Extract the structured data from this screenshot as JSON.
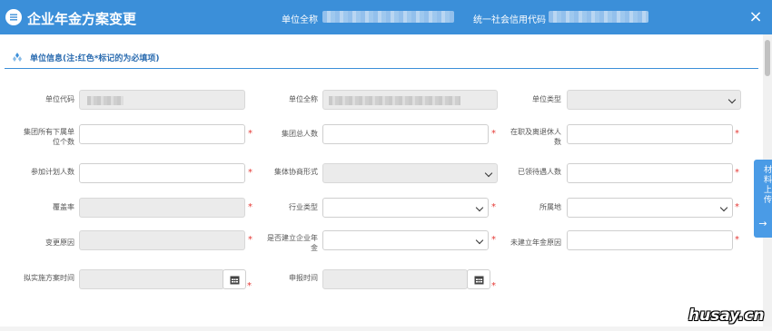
{
  "header": {
    "title": "企业年金方案变更",
    "unit_fullname_label": "单位全称",
    "credit_code_label": "统一社会信用代码",
    "close_symbol": "×"
  },
  "section": {
    "title": "单位信息(注:红色*标记的为必填项)"
  },
  "fields": {
    "unit_code": {
      "label": "单位代码"
    },
    "unit_fullname": {
      "label": "单位全称"
    },
    "unit_type": {
      "label": "单位类型"
    },
    "sub_units": {
      "label": "集团所有下属单位个数"
    },
    "group_total": {
      "label": "集团总人数"
    },
    "active_retired": {
      "label": "在职及离退休人数"
    },
    "participants": {
      "label": "参加计划人数"
    },
    "negotiation": {
      "label": "集体协商形式"
    },
    "benefit_recipients": {
      "label": "已领待遇人数"
    },
    "coverage": {
      "label": "覆盖率"
    },
    "industry_type": {
      "label": "行业类型"
    },
    "location": {
      "label": "所属地"
    },
    "change_reason": {
      "label": "变更原因"
    },
    "established": {
      "label": "是否建立企业年金"
    },
    "not_established_reason": {
      "label": "未建立年金原因"
    },
    "plan_time": {
      "label": "拟实施方案时间"
    },
    "apply_time": {
      "label": "申报时间"
    }
  },
  "required_mark": "*",
  "side_tab": {
    "label": "材料上传",
    "arrow": "→"
  },
  "watermark": "husay.cn",
  "colors": {
    "header_bg": "#3b8fd9",
    "required": "#e53935",
    "side_tab": "#4a9be6"
  }
}
